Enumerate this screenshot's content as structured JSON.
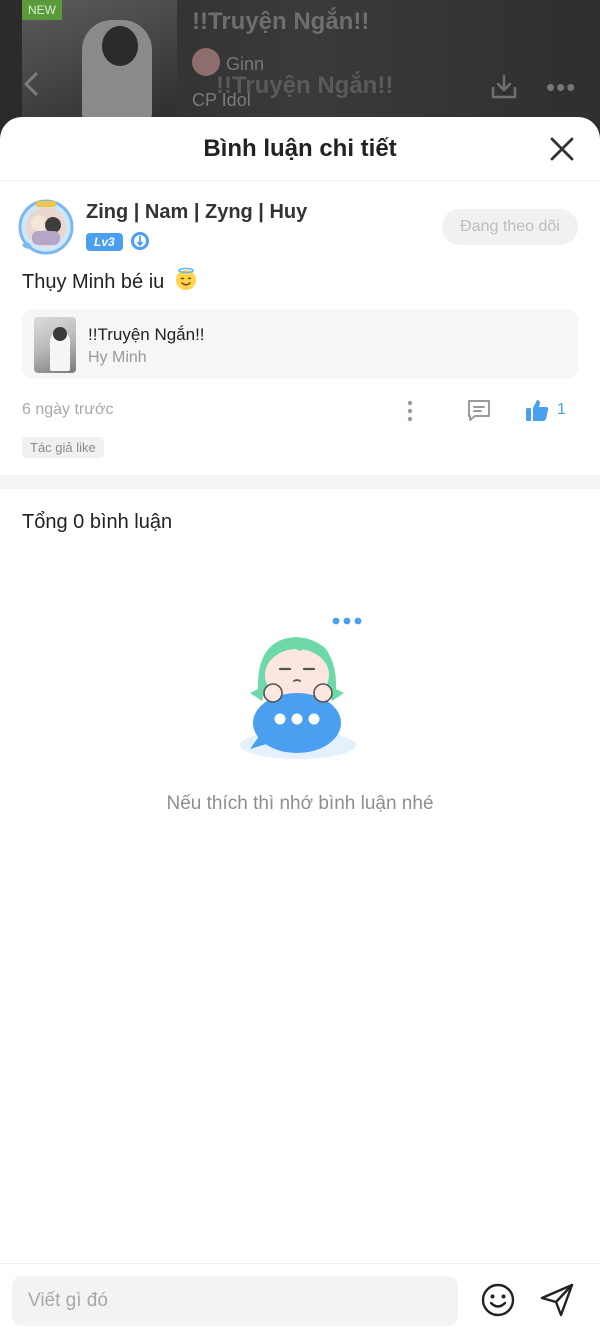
{
  "background": {
    "new_badge": "NEW",
    "story_title": "!!Truyện Ngắn!!",
    "author": "Ginn",
    "tag": "CP Idol"
  },
  "sheet": {
    "title": "Bình luận chi tiết"
  },
  "comment": {
    "username": "Zing | Nam | Zyng | Huy",
    "level": "Lv3",
    "follow_label": "Đang theo dõi",
    "text": "Thụy Minh bé iu",
    "story_card": {
      "title": "!!Truyện Ngắn!!",
      "author": "Hy Minh"
    },
    "time": "6 ngày trước",
    "like_count": "1",
    "author_tag": "Tác giả like"
  },
  "replies": {
    "total_label": "Tổng 0 bình luận",
    "empty_text": "Nếu thích thì nhớ bình luận nhé"
  },
  "input": {
    "placeholder": "Viết gì đó"
  },
  "colors": {
    "accent": "#4a9ff0",
    "mascot_hair": "#6ed9a8",
    "bubble": "#4a9ff0"
  },
  "icons": {
    "close": "close-icon",
    "more": "more-vertical-icon",
    "reply": "comment-icon",
    "like": "thumbs-up-icon",
    "emoji": "smile-icon",
    "send": "send-icon",
    "back": "chevron-left-icon",
    "download": "download-icon"
  }
}
